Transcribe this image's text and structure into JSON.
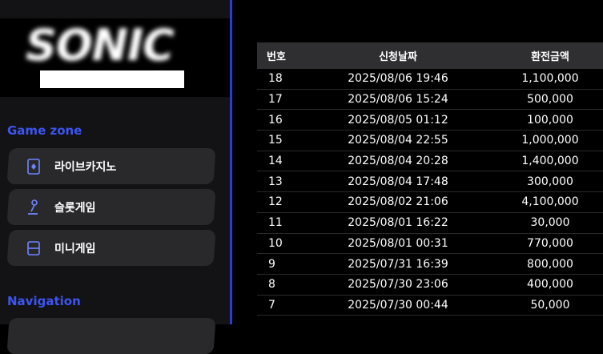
{
  "logo": {
    "text": "SONIC"
  },
  "sidebar": {
    "game_zone_title": "Game zone",
    "items": [
      {
        "label": "라이브카지노",
        "icon": "cards-icon"
      },
      {
        "label": "슬롯게임",
        "icon": "joystick-icon"
      },
      {
        "label": "미니게임",
        "icon": "minigame-icon"
      }
    ],
    "navigation_title": "Navigation"
  },
  "table": {
    "headers": {
      "no": "번호",
      "date": "신청날짜",
      "amount": "환전금액"
    },
    "rows": [
      {
        "no": "18",
        "date": "2025/08/06 19:46",
        "amount": "1,100,000"
      },
      {
        "no": "17",
        "date": "2025/08/06 15:24",
        "amount": "500,000"
      },
      {
        "no": "16",
        "date": "2025/08/05 01:12",
        "amount": "100,000"
      },
      {
        "no": "15",
        "date": "2025/08/04 22:55",
        "amount": "1,000,000"
      },
      {
        "no": "14",
        "date": "2025/08/04 20:28",
        "amount": "1,400,000"
      },
      {
        "no": "13",
        "date": "2025/08/04 17:48",
        "amount": "300,000"
      },
      {
        "no": "12",
        "date": "2025/08/02 21:06",
        "amount": "4,100,000"
      },
      {
        "no": "11",
        "date": "2025/08/01 16:22",
        "amount": "30,000"
      },
      {
        "no": "10",
        "date": "2025/08/01 00:31",
        "amount": "770,000"
      },
      {
        "no": "9",
        "date": "2025/07/31 16:39",
        "amount": "800,000"
      },
      {
        "no": "8",
        "date": "2025/07/30 23:06",
        "amount": "400,000"
      },
      {
        "no": "7",
        "date": "2025/07/30 00:44",
        "amount": "50,000"
      }
    ]
  },
  "colors": {
    "accent": "#3d55f2",
    "divider": "#2d3bd6",
    "button": "#29292c",
    "header": "#2f2f31"
  }
}
